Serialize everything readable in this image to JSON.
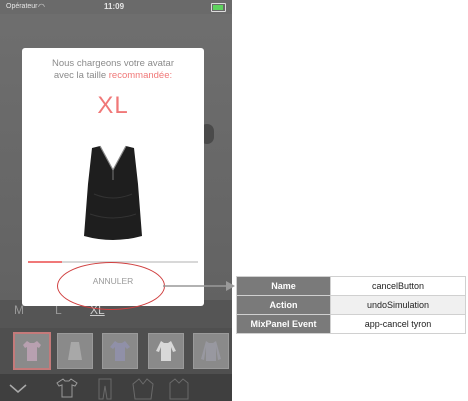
{
  "status_bar": {
    "carrier": "Opérateur",
    "time": "11:09"
  },
  "modal": {
    "message_line1": "Nous chargeons votre avatar",
    "message_line2_prefix": "avec la taille ",
    "message_line2_highlight": "recommandée:",
    "size": "XL",
    "garment_icon": "black-tank-top-image",
    "progress": 0.2,
    "cancel_label": "ANNULER"
  },
  "size_tabs": [
    "M",
    "L",
    "XL"
  ],
  "selected_size": "XL",
  "garments": [
    "tshirt-thumbnail",
    "skirt-thumbnail",
    "blouse-thumbnail",
    "sweater-thumbnail",
    "longsleeve-thumbnail"
  ],
  "bottom_icons": [
    "chevron-down-icon",
    "tshirt-icon",
    "pants-icon",
    "jacket-icon",
    "coat-icon"
  ],
  "annotation": {
    "rows": [
      {
        "key": "Name",
        "value": "cancelButton"
      },
      {
        "key": "Action",
        "value": "undoSimulation"
      },
      {
        "key": "MixPanel  Event",
        "value": "app-cancel tyron"
      }
    ]
  },
  "colors": {
    "accent": "#f07878",
    "highlight_circle": "#d04040",
    "table_header": "#7a7a7a"
  }
}
